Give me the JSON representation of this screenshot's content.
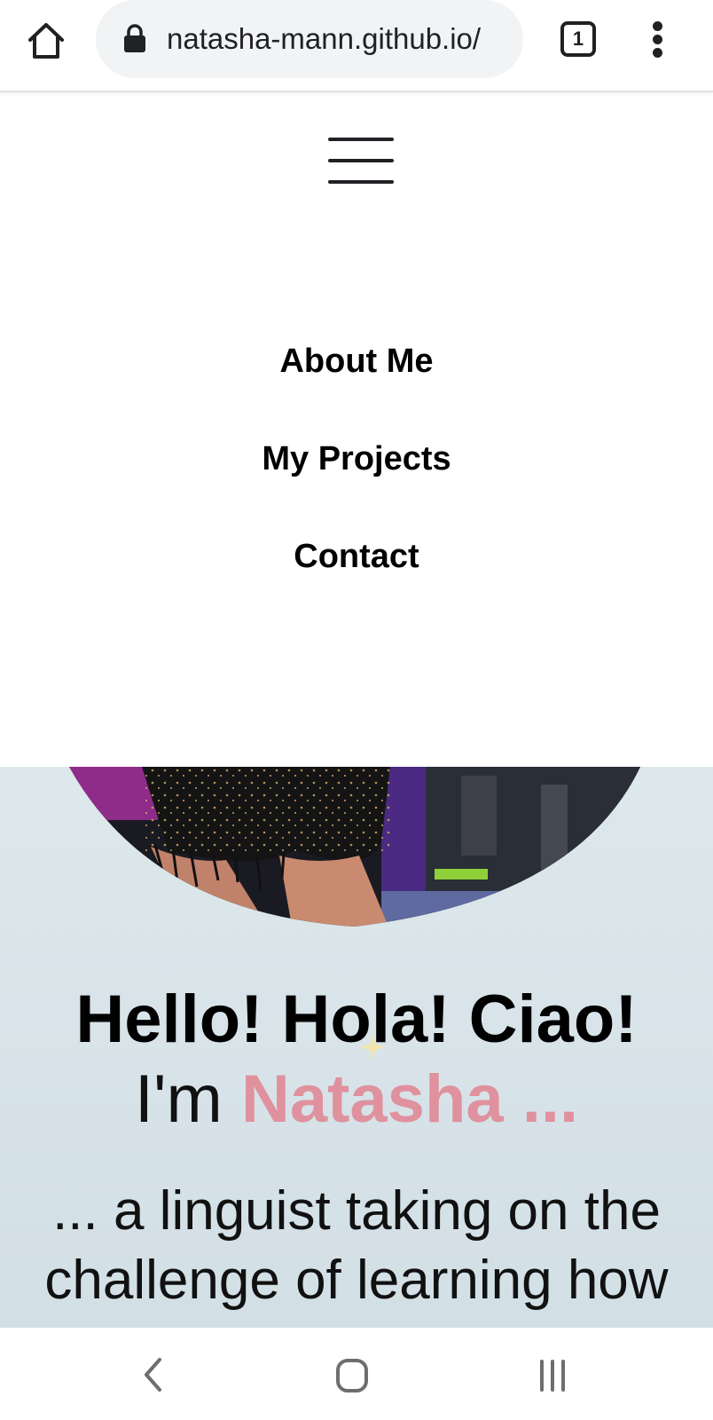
{
  "browser": {
    "url": "natasha-mann.github.io/",
    "tab_count": "1",
    "icons": [
      "home-icon",
      "lock-icon",
      "tabs-icon",
      "more-vert-icon"
    ]
  },
  "nav": {
    "menu_icon": "hamburger-icon",
    "links": [
      {
        "label": "About Me"
      },
      {
        "label": "My Projects"
      },
      {
        "label": "Contact"
      }
    ]
  },
  "hero": {
    "title": "Hello! Hola! Ciao!",
    "sub_prefix": "I'm ",
    "name": "Natasha ...",
    "body": "... a linguist taking on the challenge of learning how",
    "accent_color": "#e0919e"
  },
  "system_nav": {
    "icons": [
      "back-icon",
      "home-icon",
      "recents-icon"
    ]
  }
}
